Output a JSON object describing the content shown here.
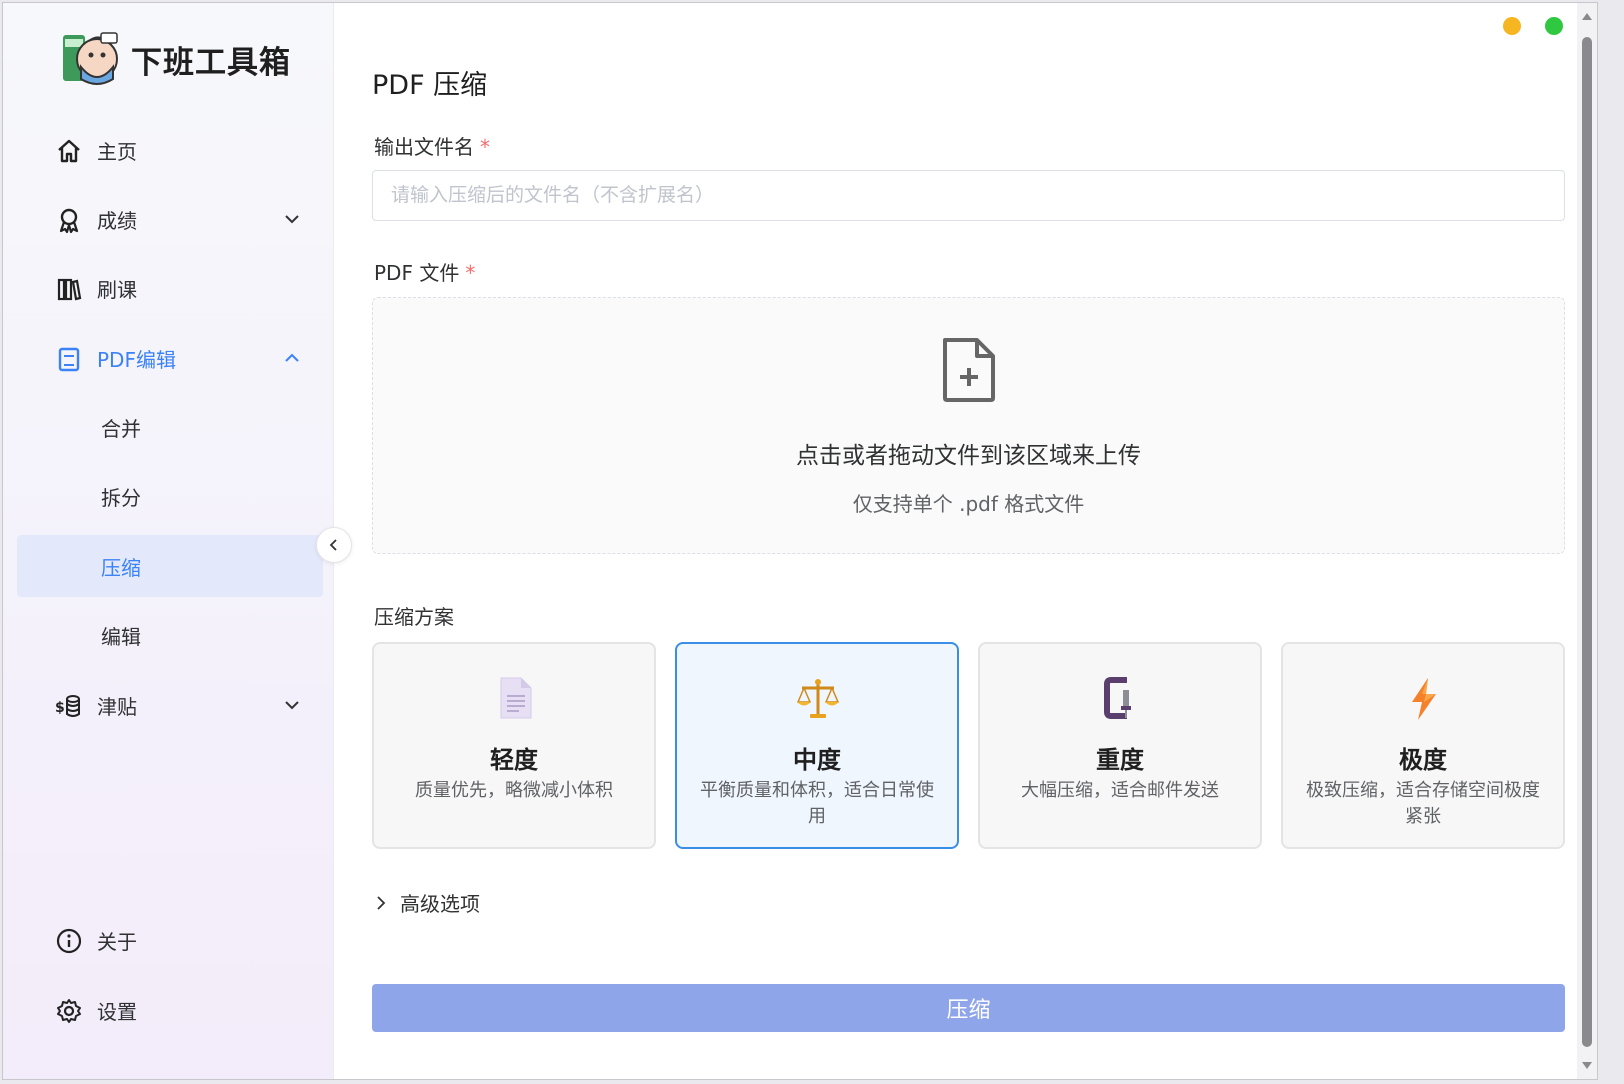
{
  "app": {
    "name": "下班工具箱"
  },
  "sidebar": {
    "items": [
      {
        "label": "主页",
        "icon": "home-icon"
      },
      {
        "label": "成绩",
        "icon": "award-icon"
      },
      {
        "label": "刷课",
        "icon": "books-icon"
      },
      {
        "label": "PDF编辑",
        "icon": "book-icon"
      },
      {
        "label": "合并"
      },
      {
        "label": "拆分"
      },
      {
        "label": "压缩"
      },
      {
        "label": "编辑"
      },
      {
        "label": "津贴",
        "icon": "coins-icon"
      }
    ],
    "bottom": [
      {
        "label": "关于",
        "icon": "info-icon"
      },
      {
        "label": "设置",
        "icon": "gear-icon"
      }
    ]
  },
  "main": {
    "title": "PDF 压缩",
    "output_label": "输出文件名",
    "required_mark": "*",
    "output_placeholder": "请输入压缩后的文件名（不含扩展名）",
    "file_label": "PDF 文件",
    "upload_main": "点击或者拖动文件到该区域来上传",
    "upload_sub": "仅支持单个 .pdf 格式文件",
    "plan_label": "压缩方案",
    "plans": [
      {
        "title": "轻度",
        "desc": "质量优先，略微减小体积",
        "icon": "document-icon"
      },
      {
        "title": "中度",
        "desc": "平衡质量和体积，适合日常使用",
        "icon": "balance-scale-icon",
        "selected": true
      },
      {
        "title": "重度",
        "desc": "大幅压缩，适合邮件发送",
        "icon": "clamp-icon"
      },
      {
        "title": "极度",
        "desc": "极致压缩，适合存储空间极度紧张",
        "icon": "lightning-icon"
      }
    ],
    "advanced_label": "高级选项",
    "submit_label": "压缩"
  },
  "colors": {
    "accent": "#3b82f6",
    "active_bg": "#e3e9fb",
    "submit_bg": "#8fa5ea",
    "selected_border": "#3a8ee6",
    "required": "#f56c6c"
  }
}
